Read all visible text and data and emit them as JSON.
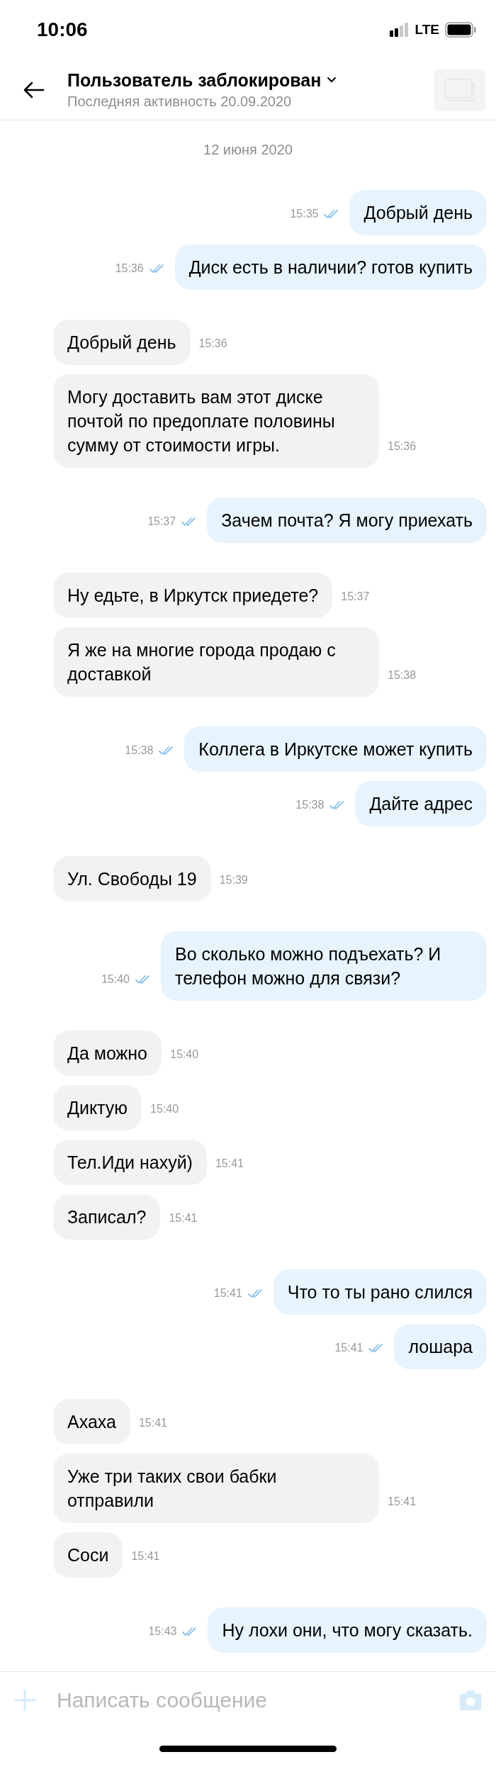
{
  "status_bar": {
    "time": "10:06",
    "network": "LTE"
  },
  "header": {
    "title": "Пользователь заблокирован",
    "subtitle": "Последняя активность 20.09.2020"
  },
  "date_separator": "12 июня 2020",
  "messages": [
    {
      "kind": "outgoing",
      "text": "Добрый день",
      "time": "15:35",
      "read": true
    },
    {
      "kind": "outgoing",
      "text": "Диск есть в наличии? готов купить",
      "time": "15:36",
      "read": true
    },
    {
      "kind": "incoming",
      "text": "Добрый день",
      "time": "15:36"
    },
    {
      "kind": "incoming",
      "text": "Могу доставить вам этот диске почтой по предоплате половины сумму от стоимости игры.",
      "time": "15:36"
    },
    {
      "kind": "outgoing",
      "text": "Зачем почта? Я могу приехать",
      "time": "15:37",
      "read": true
    },
    {
      "kind": "incoming",
      "text": "Ну едьте, в Иркутск приедете?",
      "time": "15:37"
    },
    {
      "kind": "incoming",
      "text": "Я же на многие города продаю с доставкой",
      "time": "15:38"
    },
    {
      "kind": "outgoing",
      "text": "Коллега в Иркутске может купить",
      "time": "15:38",
      "read": true
    },
    {
      "kind": "outgoing",
      "text": "Дайте адрес",
      "time": "15:38",
      "read": true
    },
    {
      "kind": "incoming",
      "text": "Ул. Свободы 19",
      "time": "15:39"
    },
    {
      "kind": "outgoing",
      "text": "Во сколько можно подъехать? И телефон можно для связи?",
      "time": "15:40",
      "read": true
    },
    {
      "kind": "incoming",
      "text": "Да можно",
      "time": "15:40"
    },
    {
      "kind": "incoming",
      "text": "Диктую",
      "time": "15:40"
    },
    {
      "kind": "incoming",
      "text": "Тел.Иди нахуй)",
      "time": "15:41"
    },
    {
      "kind": "incoming",
      "text": "Записал?",
      "time": "15:41"
    },
    {
      "kind": "outgoing",
      "text": "Что то ты рано слился",
      "time": "15:41",
      "read": true
    },
    {
      "kind": "outgoing",
      "text": "лошара",
      "time": "15:41",
      "read": true
    },
    {
      "kind": "incoming",
      "text": "Ахаха",
      "time": "15:41"
    },
    {
      "kind": "incoming",
      "text": "Уже три таких свои бабки отправили",
      "time": "15:41"
    },
    {
      "kind": "incoming",
      "text": "Соси",
      "time": "15:41"
    },
    {
      "kind": "outgoing",
      "text": "Ну лохи они, что могу сказать.",
      "time": "15:43",
      "read": true
    }
  ],
  "composer": {
    "placeholder": "Написать сообщение",
    "disabled": true
  }
}
